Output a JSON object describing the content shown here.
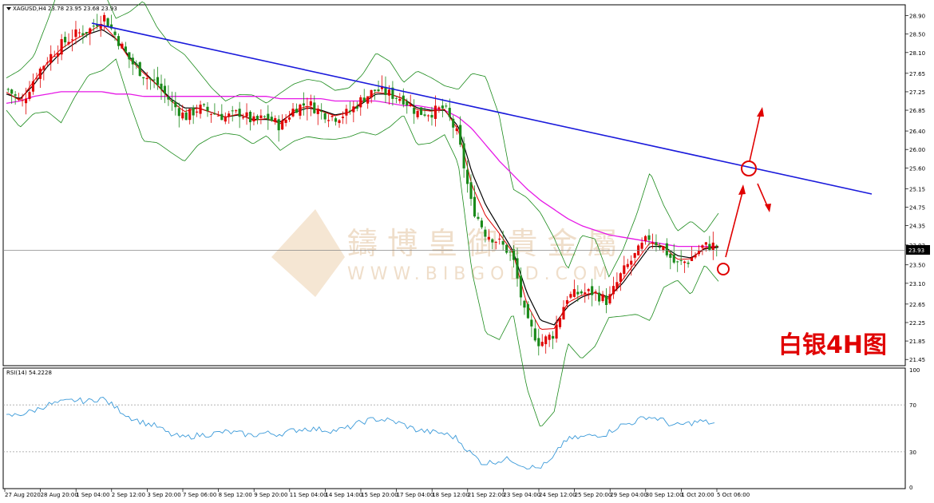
{
  "header": {
    "main_label": "XAGUSD,H4  23.78 23.95 23.68 23.93",
    "rsi_label": "RSI(14) 54.2228"
  },
  "price_tag": "23.93",
  "annotation": "白银4H图",
  "watermark": {
    "chinese": "鑄 博 皇 御 貴 金 屬",
    "url": "WWW.BIBGOLD.COM"
  },
  "colors": {
    "trendline": "#1a1adb",
    "ma_slow": "#e619e6",
    "ma_fast": "#000000",
    "ma_fastest": "#e00000",
    "bollinger": "#1a8a1a",
    "rsi": "#3b9ad9",
    "bull": "#e00000",
    "bear": "#1a8a1a",
    "annotation": "#e00000"
  },
  "chart_data": [
    {
      "type": "candlestick",
      "symbol": "XAGUSD",
      "timeframe": "H4",
      "ohlc_last": {
        "open": 23.78,
        "high": 23.95,
        "low": 23.68,
        "close": 23.93
      },
      "y_ticks": [
        28.9,
        28.5,
        28.1,
        27.65,
        27.25,
        26.85,
        26.4,
        26.0,
        25.6,
        25.15,
        24.75,
        24.35,
        23.93,
        23.5,
        23.1,
        22.65,
        22.25,
        21.85,
        21.45
      ],
      "ylim": [
        21.35,
        29.1
      ],
      "x_ticks": [
        "27 Aug 2020",
        "28 Aug 20:00",
        "1 Sep 04:00",
        "2 Sep 12:00",
        "3 Sep 20:00",
        "7 Sep 06:00",
        "8 Sep 12:00",
        "9 Sep 20:00",
        "11 Sep 04:00",
        "14 Sep 14:00",
        "15 Sep 20:00",
        "17 Sep 04:00",
        "18 Sep 12:00",
        "21 Sep 22:00",
        "23 Sep 04:00",
        "24 Sep 12:00",
        "25 Sep 20:00",
        "29 Sep 04:00",
        "30 Sep 12:00",
        "1 Oct 20:00",
        "5 Oct 06:00"
      ],
      "close_path": [
        27.3,
        27.0,
        27.6,
        28.0,
        28.3,
        28.5,
        28.6,
        28.9,
        28.4,
        27.9,
        27.6,
        27.4,
        27.0,
        26.7,
        26.9,
        26.8,
        26.7,
        26.8,
        26.6,
        26.7,
        26.5,
        26.9,
        27.0,
        26.8,
        26.7,
        26.8,
        27.1,
        27.3,
        27.2,
        27.1,
        26.8,
        26.8,
        26.9,
        26.3,
        24.8,
        24.2,
        24.0,
        23.7,
        22.3,
        21.8,
        22.0,
        22.8,
        22.9,
        22.9,
        22.7,
        23.3,
        23.7,
        24.1,
        23.9,
        23.5,
        23.6,
        23.9,
        23.93
      ],
      "series": [
        {
          "name": "MA fast",
          "values": [
            27.2,
            27.1,
            27.4,
            27.8,
            28.1,
            28.3,
            28.5,
            28.6,
            28.4,
            28.0,
            27.7,
            27.4,
            27.1,
            26.9,
            26.9,
            26.8,
            26.7,
            26.75,
            26.65,
            26.65,
            26.6,
            26.8,
            26.9,
            26.85,
            26.75,
            26.8,
            27.0,
            27.2,
            27.2,
            27.1,
            26.9,
            26.85,
            26.85,
            26.5,
            25.5,
            24.8,
            24.3,
            23.8,
            22.9,
            22.3,
            22.2,
            22.6,
            22.8,
            22.9,
            22.8,
            23.1,
            23.5,
            23.9,
            23.9,
            23.7,
            23.65,
            23.85,
            23.88
          ]
        },
        {
          "name": "MA slow",
          "values": [
            27.0,
            27.05,
            27.15,
            27.2,
            27.25,
            27.25,
            27.25,
            27.25,
            27.2,
            27.2,
            27.15,
            27.15,
            27.15,
            27.15,
            27.15,
            27.15,
            27.15,
            27.15,
            27.15,
            27.15,
            27.1,
            27.1,
            27.1,
            27.1,
            27.05,
            27.05,
            27.05,
            27.05,
            27.0,
            26.95,
            26.95,
            26.9,
            26.85,
            26.7,
            26.45,
            26.1,
            25.75,
            25.45,
            25.15,
            24.9,
            24.7,
            24.5,
            24.35,
            24.25,
            24.15,
            24.1,
            24.05,
            24.0,
            23.95,
            23.9,
            23.9,
            23.9,
            23.9
          ]
        }
      ]
    },
    {
      "type": "line",
      "indicator": "RSI(14)",
      "last_value": 54.2228,
      "y_ticks": [
        100,
        70,
        30,
        0
      ],
      "ylim": [
        0,
        100
      ],
      "levels": [
        70,
        30
      ],
      "values": [
        60,
        62,
        65,
        70,
        72,
        74,
        73,
        76,
        68,
        60,
        55,
        52,
        45,
        42,
        44,
        45,
        47,
        46,
        44,
        46,
        45,
        48,
        50,
        49,
        48,
        50,
        55,
        58,
        57,
        54,
        49,
        47,
        46,
        42,
        30,
        20,
        22,
        24,
        18,
        16,
        22,
        40,
        42,
        44,
        45,
        52,
        55,
        60,
        58,
        52,
        54,
        56,
        54
      ]
    }
  ]
}
